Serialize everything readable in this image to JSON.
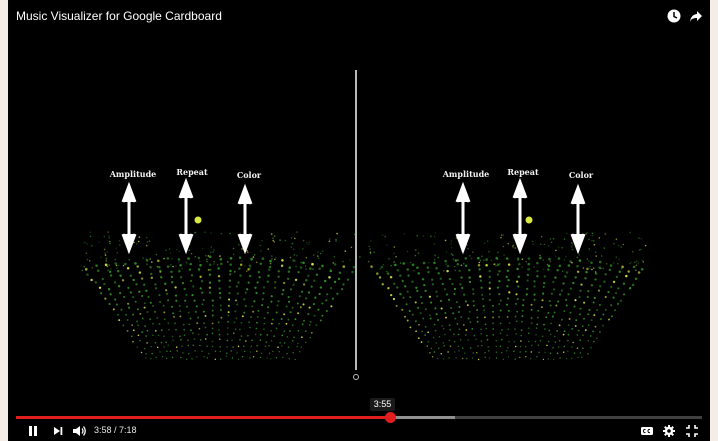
{
  "video": {
    "title": "Music Visualizer for Google Cardboard",
    "labels": [
      "Amplitude",
      "Repeat",
      "Color"
    ]
  },
  "top_controls": {
    "icons": [
      "watch-later-icon",
      "share-icon"
    ]
  },
  "player": {
    "tooltip_time": "3:55",
    "current_time": "3:58",
    "separator": " / ",
    "duration": "7:18",
    "played_fraction": 0.545,
    "buffered_fraction": 0.64,
    "controls": [
      "pause-icon",
      "next-icon",
      "volume-icon",
      "captions-icon",
      "settings-icon",
      "exit-fullscreen-icon"
    ],
    "colors": {
      "progress": "#e01e1e",
      "points": "#2f8f2a",
      "highlight": "#d8e840"
    }
  }
}
